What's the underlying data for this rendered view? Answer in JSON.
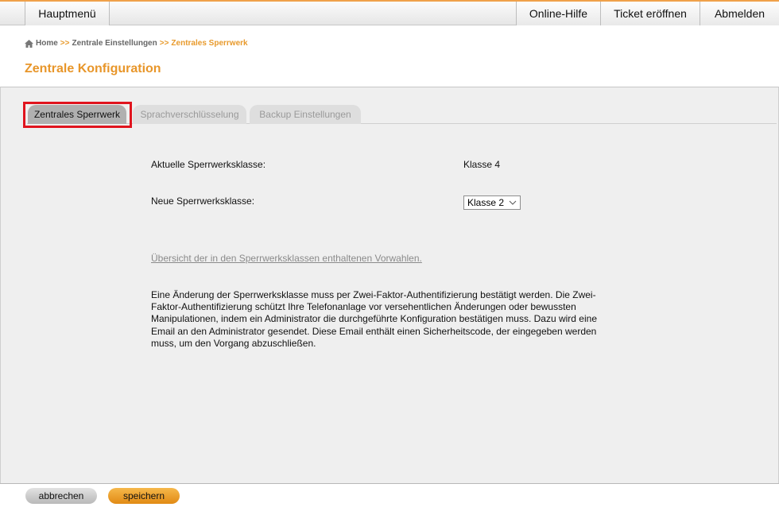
{
  "topnav": {
    "main_menu": "Hauptmenü",
    "online_help": "Online-Hilfe",
    "open_ticket": "Ticket eröffnen",
    "logout": "Abmelden"
  },
  "breadcrumb": {
    "home": "Home",
    "sep1": ">>",
    "central_settings": "Zentrale Einstellungen",
    "sep2": ">>",
    "current": "Zentrales Sperrwerk"
  },
  "page_title": "Zentrale Konfiguration",
  "tabs": [
    {
      "label": "Zentrales Sperrwerk",
      "active": true
    },
    {
      "label": "Sprachverschlüsselung",
      "active": false
    },
    {
      "label": "Backup Einstellungen",
      "active": false
    }
  ],
  "form": {
    "current_class_label": "Aktuelle Sperrwerksklasse:",
    "current_class_value": "Klasse 4",
    "new_class_label": "Neue Sperrwerksklasse:",
    "new_class_selected": "Klasse 2"
  },
  "overview_link": "Übersicht der in den Sperrwerksklassen enthaltenen Vorwahlen.",
  "info_text": "Eine Änderung der Sperrwerksklasse muss per Zwei-Faktor-Authentifizierung bestätigt werden. Die Zwei-Faktor-Authentifizierung schützt Ihre Telefonanlage vor versehentlichen Änderungen oder bewussten Manipulationen, indem ein Administrator die durchgeführte Konfiguration bestätigen muss. Dazu wird eine Email an den Administrator gesendet. Diese Email enthält einen Sicherheitscode, der eingegeben werden muss, um den Vorgang abzuschließen.",
  "footer": {
    "cancel": "abbrechen",
    "save": "speichern"
  },
  "colors": {
    "accent": "#e8962a",
    "highlight": "#e0141e"
  },
  "icons": {
    "home": "home-icon",
    "select": "chevron-down-icon"
  }
}
